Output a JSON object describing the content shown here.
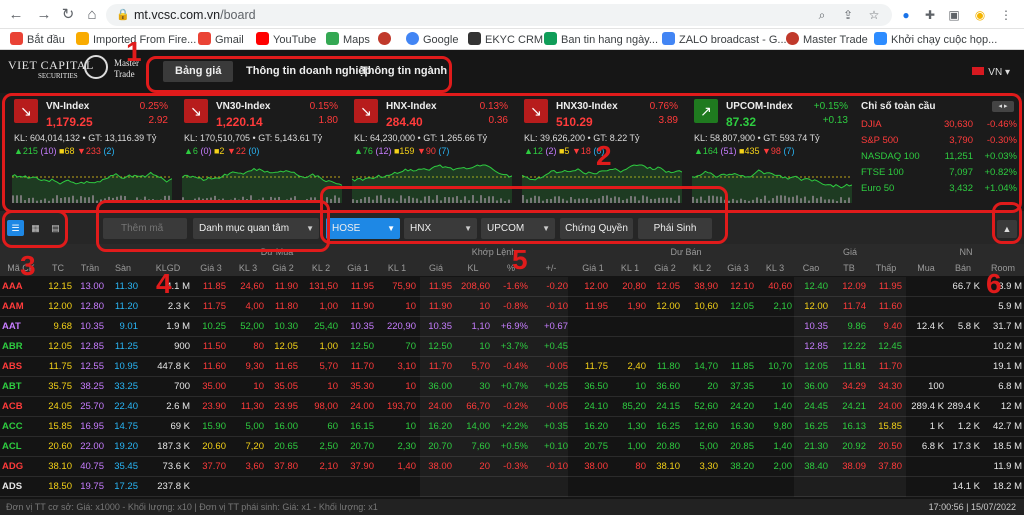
{
  "browser": {
    "url_domain": "mt.vcsc.com.vn",
    "url_path": "/board",
    "bookmarks": [
      "Bắt đầu",
      "Imported From Fire...",
      "Gmail",
      "YouTube",
      "Maps",
      "",
      "Google",
      "EKYC CRM",
      "Ban tin hang ngày...",
      "ZALO broadcast - G...",
      "Master Trade",
      "Khởi chạy cuộc họp..."
    ]
  },
  "app": {
    "logo_line1": "VIET CAPITAL",
    "logo_line2": "SECURITIES",
    "logo_line3": "Master Trade",
    "tabs": [
      "Bảng giá",
      "Thông tin doanh nghiệp",
      "Thông tin ngành"
    ],
    "lang": "VN"
  },
  "indices": [
    {
      "name": "VN-Index",
      "value": "1,179.25",
      "pct": "0.25%",
      "chg": "2.92",
      "kl": "KL: 604,014,132 • GT: 13,116.39 Tỷ",
      "up": "215",
      "up2": "(10)",
      "ref": "68",
      "dn": "233",
      "dn2": "(2)",
      "trend": "down"
    },
    {
      "name": "VN30-Index",
      "value": "1,220.14",
      "pct": "0.15%",
      "chg": "1.80",
      "kl": "KL: 170,510,705 • GT: 5,143.61 Tỷ",
      "up": "6",
      "up2": "(0)",
      "ref": "2",
      "dn": "22",
      "dn2": "(0)",
      "trend": "down"
    },
    {
      "name": "HNX-Index",
      "value": "284.40",
      "pct": "0.13%",
      "chg": "0.36",
      "kl": "KL: 64,230,000 • GT: 1,265.66 Tỷ",
      "up": "76",
      "up2": "(12)",
      "ref": "159",
      "dn": "90",
      "dn2": "(7)",
      "trend": "down"
    },
    {
      "name": "HNX30-Index",
      "value": "510.29",
      "pct": "0.76%",
      "chg": "3.89",
      "kl": "KL: 39,626,200 • GT: 8.22 Tỷ",
      "up": "12",
      "up2": "(2)",
      "ref": "5",
      "dn": "18",
      "dn2": "(0)",
      "trend": "down"
    },
    {
      "name": "UPCOM-Index",
      "value": "87.32",
      "pct": "+0.15%",
      "chg": "+0.13",
      "kl": "KL: 58,807,900 • GT: 593.74 Tỷ",
      "up": "164",
      "up2": "(51)",
      "ref": "435",
      "dn": "98",
      "dn2": "(7)",
      "trend": "up"
    }
  ],
  "global": {
    "title": "Chỉ số toàn cầu",
    "nav": "◂ ▸",
    "items": [
      {
        "name": "DJIA",
        "value": "30,630",
        "pct": "-0.46%",
        "trend": "down"
      },
      {
        "name": "S&P 500",
        "value": "3,790",
        "pct": "-0.30%",
        "trend": "down"
      },
      {
        "name": "NASDAQ 100",
        "value": "11,251",
        "pct": "+0.03%",
        "trend": "up"
      },
      {
        "name": "FTSE 100",
        "value": "7,097",
        "pct": "+0.82%",
        "trend": "up"
      },
      {
        "name": "Euro 50",
        "value": "3,432",
        "pct": "+1.04%",
        "trend": "up"
      }
    ]
  },
  "toolbar": {
    "search_placeholder": "Thêm mã",
    "watchlist": "Danh mục quan tâm",
    "exchanges": [
      "HOSE",
      "HNX",
      "UPCOM"
    ],
    "buttons": [
      "Chứng Quyền",
      "Phái Sinh"
    ]
  },
  "table": {
    "group_headers": [
      "Dư Mua",
      "Khớp Lệnh",
      "Dư Bán",
      "Giá",
      "NN"
    ],
    "headers": [
      "Mã CK",
      "TC",
      "Trần",
      "Sàn",
      "KLGD",
      "Giá 3",
      "KL 3",
      "Giá 2",
      "KL 2",
      "Giá 1",
      "KL 1",
      "Giá",
      "KL",
      "%",
      "+/-",
      "Giá 1",
      "KL 1",
      "Giá 2",
      "KL 2",
      "Giá 3",
      "KL 3",
      "Cao",
      "TB",
      "Thấp",
      "Mua",
      "Bán",
      "Room"
    ],
    "rows": [
      [
        "AAA",
        "12.15",
        "13.00",
        "11.30",
        "4.1 M",
        "11.85",
        "24,60",
        "11.90",
        "131,50",
        "11.95",
        "75,90",
        "11.95",
        "208,60",
        "-1.6%",
        "-0.20",
        "12.00",
        "20,80",
        "12.05",
        "38,90",
        "12.10",
        "40,60",
        "12.40",
        "12.09",
        "11.95",
        "",
        "66.7 K",
        "3.9 M"
      ],
      [
        "AAM",
        "12.00",
        "12.80",
        "11.20",
        "2.3 K",
        "11.75",
        "4,00",
        "11.80",
        "1,00",
        "11.90",
        "10",
        "11.90",
        "10",
        "-0.8%",
        "-0.10",
        "11.95",
        "1,90",
        "12.00",
        "10,60",
        "12.05",
        "2,10",
        "12.00",
        "11.74",
        "11.60",
        "",
        "",
        "5.9 M"
      ],
      [
        "AAT",
        "9.68",
        "10.35",
        "9.01",
        "1.9 M",
        "10.25",
        "52,00",
        "10.30",
        "25,40",
        "10.35",
        "220,90",
        "10.35",
        "1,10",
        "+6.9%",
        "+0.67",
        "",
        "",
        "",
        "",
        "",
        "",
        "10.35",
        "9.86",
        "9.40",
        "12.4 K",
        "5.8 K",
        "31.7 M"
      ],
      [
        "ABR",
        "12.05",
        "12.85",
        "11.25",
        "900",
        "11.50",
        "80",
        "12.05",
        "1,00",
        "12.50",
        "70",
        "12.50",
        "10",
        "+3.7%",
        "+0.45",
        "",
        "",
        "",
        "",
        "",
        "",
        "12.85",
        "12.22",
        "12.45",
        "",
        "",
        "10.2 M"
      ],
      [
        "ABS",
        "11.75",
        "12.55",
        "10.95",
        "447.8 K",
        "11.60",
        "9,30",
        "11.65",
        "5,70",
        "11.70",
        "3,10",
        "11.70",
        "5,70",
        "-0.4%",
        "-0.05",
        "11.75",
        "2,40",
        "11.80",
        "14,70",
        "11.85",
        "10,70",
        "12.05",
        "11.81",
        "11.70",
        "",
        "",
        "19.1 M"
      ],
      [
        "ABT",
        "35.75",
        "38.25",
        "33.25",
        "700",
        "35.00",
        "10",
        "35.05",
        "10",
        "35.30",
        "10",
        "36.00",
        "30",
        "+0.7%",
        "+0.25",
        "36.50",
        "10",
        "36.60",
        "20",
        "37.35",
        "10",
        "36.00",
        "34.29",
        "34.30",
        "100",
        "",
        "6.8 M"
      ],
      [
        "ACB",
        "24.05",
        "25.70",
        "22.40",
        "2.6 M",
        "23.90",
        "11,30",
        "23.95",
        "98,00",
        "24.00",
        "193,70",
        "24.00",
        "66,70",
        "-0.2%",
        "-0.05",
        "24.10",
        "85,20",
        "24.15",
        "52,60",
        "24.20",
        "1,40",
        "24.45",
        "24.21",
        "24.00",
        "289.4 K",
        "289.4 K",
        "12 M"
      ],
      [
        "ACC",
        "15.85",
        "16.95",
        "14.75",
        "69 K",
        "15.90",
        "5,00",
        "16.00",
        "60",
        "16.15",
        "10",
        "16.20",
        "14,00",
        "+2.2%",
        "+0.35",
        "16.20",
        "1,30",
        "16.25",
        "12,60",
        "16.30",
        "9,80",
        "16.25",
        "16.13",
        "15.85",
        "1 K",
        "1.2 K",
        "42.7 M"
      ],
      [
        "ACL",
        "20.60",
        "22.00",
        "19.20",
        "187.3 K",
        "20.60",
        "7,20",
        "20.65",
        "2,50",
        "20.70",
        "2,30",
        "20.70",
        "7,60",
        "+0.5%",
        "+0.10",
        "20.75",
        "1,00",
        "20.80",
        "5,00",
        "20.85",
        "1,40",
        "21.30",
        "20.92",
        "20.50",
        "6.8 K",
        "17.3 K",
        "18.5 M"
      ],
      [
        "ADG",
        "38.10",
        "40.75",
        "35.45",
        "73.6 K",
        "37.70",
        "3,60",
        "37.80",
        "2,10",
        "37.90",
        "1,40",
        "38.00",
        "20",
        "-0.3%",
        "-0.10",
        "38.00",
        "80",
        "38.10",
        "3,30",
        "38.20",
        "2,00",
        "38.40",
        "38.09",
        "37.80",
        "",
        "",
        "11.9 M"
      ],
      [
        "ADS",
        "18.50",
        "19.75",
        "17.25",
        "237.8 K",
        "",
        "",
        "",
        "",
        "",
        "",
        "",
        "",
        "",
        "",
        "",
        "",
        "",
        "",
        "",
        "",
        "",
        "",
        "",
        "",
        "14.1 K",
        "18.2 M"
      ]
    ]
  },
  "footer": {
    "left": "Đơn vị TT cơ sở: Giá: x1000 - Khối lượng: x10 | Đơn vị TT phái sinh: Giá: x1 - Khối lượng: x1",
    "right": "17:00:56 | 15/07/2022"
  },
  "annotations": [
    "1",
    "2",
    "3",
    "4",
    "5",
    "6"
  ],
  "colors": {
    "up": "#2ecc40",
    "down": "#ff3b3b",
    "ref": "#f5d218",
    "ceiling": "#c77dff",
    "floor": "#29b6f6",
    "annotation": "#e01b1b"
  }
}
